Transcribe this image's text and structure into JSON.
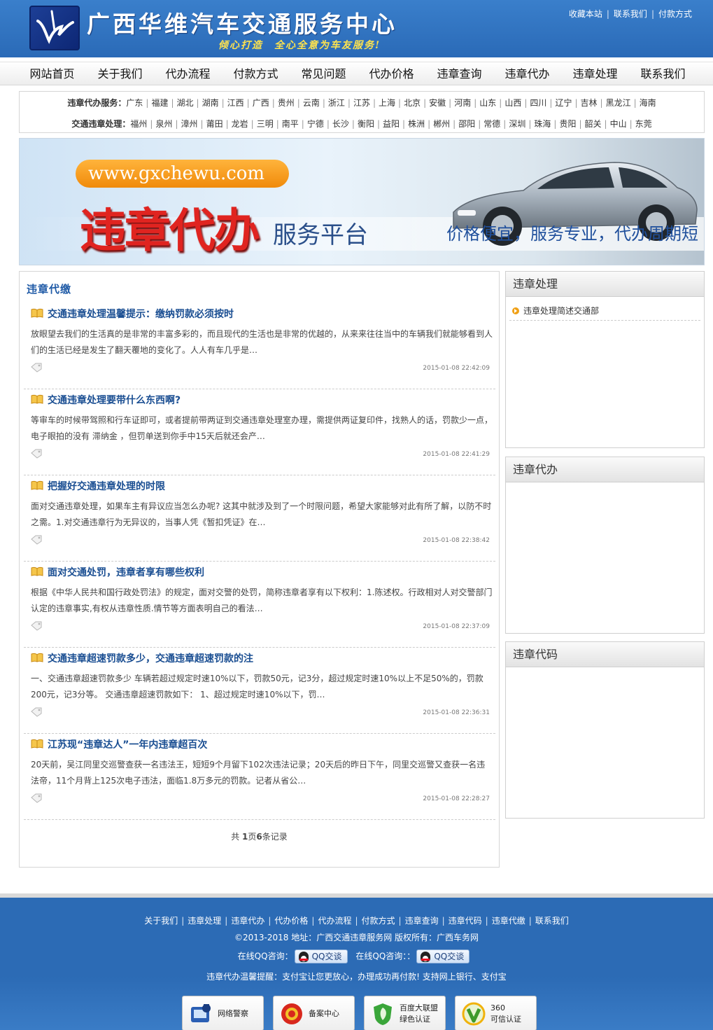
{
  "header": {
    "site_title": "广西华维汽车交通服务中心",
    "slogan": "倾心打造　全心全意为车友服务!",
    "top_links": [
      "收藏本站",
      "联系我们",
      "付款方式"
    ]
  },
  "nav": [
    "网站首页",
    "关于我们",
    "代办流程",
    "付款方式",
    "常见问题",
    "代办价格",
    "违章查询",
    "违章代办",
    "违章处理",
    "联系我们"
  ],
  "areas": {
    "service_label": "违章代办服务：",
    "service_items": [
      "广东",
      "福建",
      "湖北",
      "湖南",
      "江西",
      "广西",
      "贵州",
      "云南",
      "浙江",
      "江苏",
      "上海",
      "北京",
      "安徽",
      "河南",
      "山东",
      "山西",
      "四川",
      "辽宁",
      "吉林",
      "黑龙江",
      "海南"
    ],
    "process_label": "交通违章处理：",
    "process_items": [
      "福州",
      "泉州",
      "漳州",
      "莆田",
      "龙岩",
      "三明",
      "南平",
      "宁德",
      "长沙",
      "衡阳",
      "益阳",
      "株洲",
      "郴州",
      "邵阳",
      "常德",
      "深圳",
      "珠海",
      "贵阳",
      "韶关",
      "中山",
      "东莞"
    ]
  },
  "banner": {
    "url": "www.gxchewu.com",
    "headline": "违章代办",
    "subline": "服务平台",
    "tagline": "价格便宜，服务专业，代办周期短"
  },
  "main": {
    "title": "违章代缴",
    "articles": [
      {
        "title": "交通违章处理温馨提示：缴纳罚款必须按时",
        "summary": "放眼望去我们的生活真的是非常的丰富多彩的，而且现代的生活也是非常的优越的，从来来往往当中的车辆我们就能够看到人们的生活已经是发生了翻天覆地的变化了。人人有车几乎是…",
        "date": "2015-01-08 22:42:09"
      },
      {
        "title": "交通违章处理要带什么东西啊?",
        "summary": "等审车的时候带驾照和行车证即可，或者提前带两证到交通违章处理室办理，需提供两证复印件，找熟人的话，罚款少一点，电子眼拍的没有 滞纳金 ，但罚单送到你手中15天后就还会产…",
        "date": "2015-01-08 22:41:29"
      },
      {
        "title": "把握好交通违章处理的时限",
        "summary": "面对交通违章处理，如果车主有异议应当怎么办呢? 这其中就涉及到了一个时限问题，希望大家能够对此有所了解，以防不时之需。1.对交通违章行为无异议的，当事人凭《暂扣凭证》在…",
        "date": "2015-01-08 22:38:42"
      },
      {
        "title": "面对交通处罚，违章者享有哪些权利",
        "summary": "根据《中华人民共和国行政处罚法》的规定，面对交警的处罚，简称违章者享有以下权利：1.陈述权。行政相对人对交警部门认定的违章事实,有权从违章性质.情节等方面表明自己的看法…",
        "date": "2015-01-08 22:37:09"
      },
      {
        "title": "交通违章超速罚款多少，交通违章超速罚款的注",
        "summary": "一、交通违章超速罚款多少 车辆若超过规定时速10%以下，罚款50元，记3分，超过规定时速10%以上不足50%的，罚款200元，记3分等。 交通违章超速罚款如下： 1、超过规定时速10%以下，罚…",
        "date": "2015-01-08 22:36:31"
      },
      {
        "title": "江苏现“违章达人”一年内违章超百次",
        "summary": "20天前，吴江同里交巡警查获一名违法王，短短9个月留下102次违法记录；20天后的昨日下午，同里交巡警又查获一名违法帝，11个月背上125次电子违法，面临1.8万多元的罚款。记者从省公…",
        "date": "2015-01-08 22:28:27"
      }
    ],
    "pager": {
      "prefix": "共 ",
      "pages": "1",
      "mid": "页",
      "count": "6",
      "suffix": "条记录"
    }
  },
  "sidebar": [
    {
      "title": "违章处理",
      "items": [
        "违章处理简述交通部"
      ]
    },
    {
      "title": "违章代办",
      "items": []
    },
    {
      "title": "违章代码",
      "items": []
    }
  ],
  "footer": {
    "links": [
      "关于我们",
      "违章处理",
      "违章代办",
      "代办价格",
      "代办流程",
      "付款方式",
      "违章查询",
      "违章代码",
      "违章代缴",
      "联系我们"
    ],
    "copyright": "©2013-2018 地址：广西交通违章服务网 版权所有：广西车务网",
    "qq_label_1": "在线QQ咨询：",
    "qq_label_2": "在线QQ咨询：：",
    "qq_button": "QQ交谈",
    "tip": "违章代办温馨提醒：支付宝让您更放心，办理成功再付款! 支持网上银行、支付宝",
    "badges": [
      {
        "line1": "网络警察",
        "line2": ""
      },
      {
        "line1": "备案中心",
        "line2": ""
      },
      {
        "line1": "百度大联盟",
        "line2": "绿色认证"
      },
      {
        "line1": "360",
        "line2": "可信认证"
      }
    ]
  }
}
